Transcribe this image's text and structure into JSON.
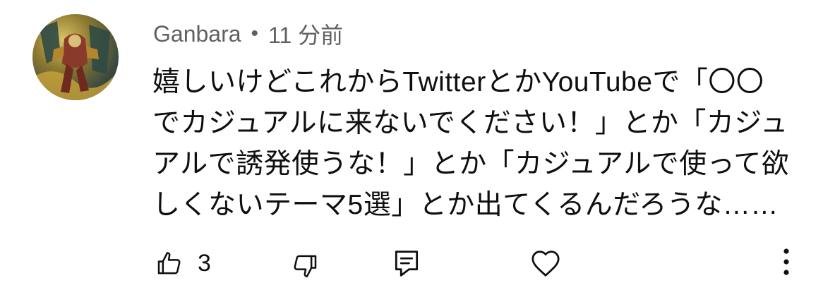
{
  "comment": {
    "author": "Ganbara",
    "separator": "•",
    "time": "11 分前",
    "text_lines": [
      "嬉しいけどこれからTwitterとかYouTubeで「〇〇",
      "でカジュアルに来ないでください！」とか「カジュ",
      "アルで誘発使うな！」とか「カジュアルで使って欲",
      "しくないテーマ5選」とか出てくるんだろうな……"
    ]
  },
  "actions": {
    "like_count": "3",
    "icons": {
      "like": "thumbs-up-icon",
      "dislike": "thumbs-down-icon",
      "reply": "reply-icon",
      "heart": "heart-icon",
      "more": "more-vert-icon"
    }
  }
}
